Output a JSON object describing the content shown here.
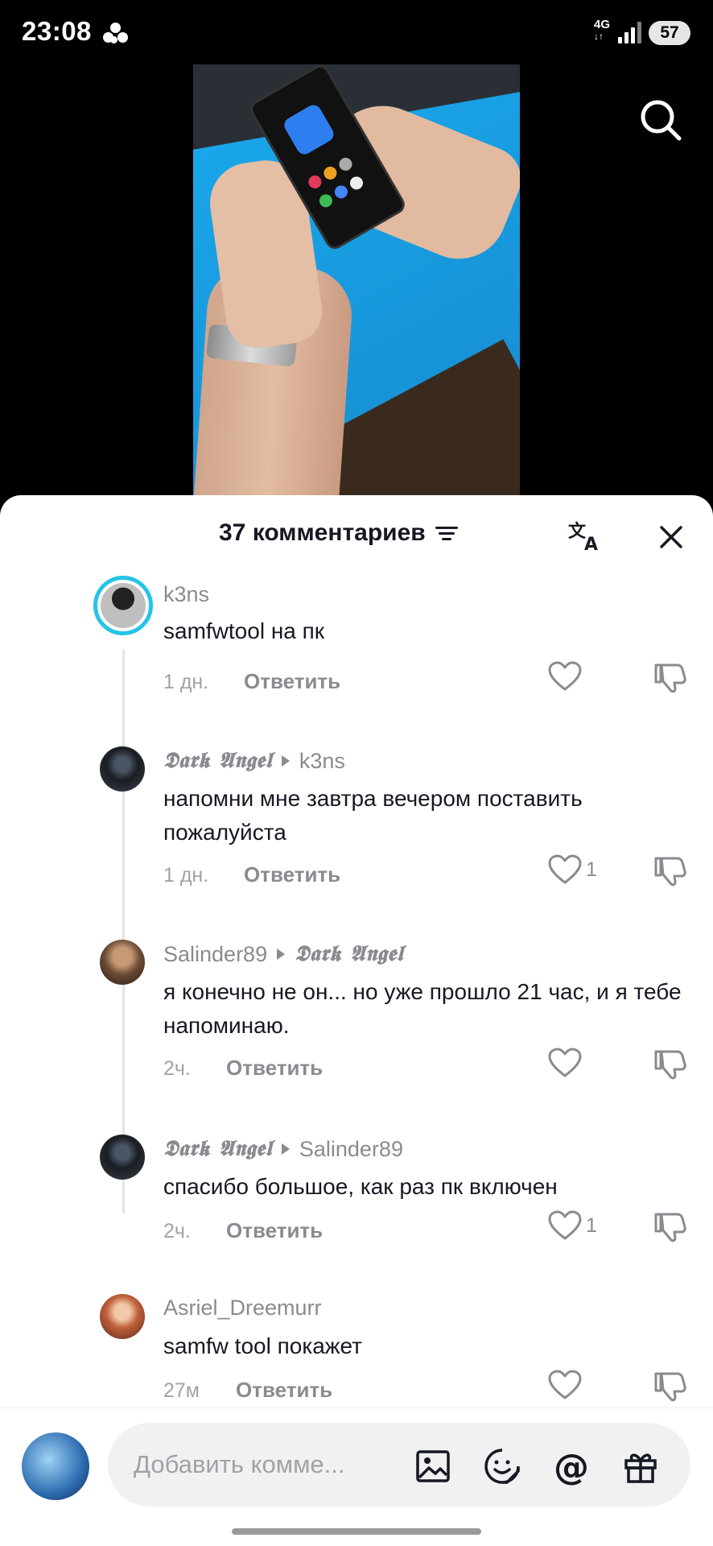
{
  "status_bar": {
    "time": "23:08",
    "network": "4G",
    "battery": "57"
  },
  "icons": {
    "search": "search-icon",
    "translate": "translate-icon",
    "close": "close-icon",
    "filter": "sort-filter-icon",
    "like": "heart-outline-icon",
    "dislike": "thumbs-down-icon",
    "image": "image-icon",
    "emoji": "emoji-icon",
    "mention": "at-icon",
    "gift": "gift-icon"
  },
  "sheet": {
    "title": "37 комментариев"
  },
  "comments": [
    {
      "user": "k3ns",
      "reply_to": "",
      "text": "samfwtool на пк",
      "time": "1 дн.",
      "reply_label": "Ответить",
      "likes": ""
    },
    {
      "user": "𝕯𝖆𝖗𝖐 𝕬𝖓𝖌𝖊𝖑",
      "reply_to": "k3ns",
      "text": "напомни мне завтра вечером поставить пожалуйста",
      "time": "1 дн.",
      "reply_label": "Ответить",
      "likes": "1"
    },
    {
      "user": "Salinder89",
      "reply_to": "𝕯𝖆𝖗𝖐 𝕬𝖓𝖌𝖊𝖑",
      "text": "я конечно не он... но уже прошло 21 час, и я тебе напоминаю.",
      "time": "2ч.",
      "reply_label": "Ответить",
      "likes": ""
    },
    {
      "user": "𝕯𝖆𝖗𝖐 𝕬𝖓𝖌𝖊𝖑",
      "reply_to": "Salinder89",
      "text": "спасибо большое, как раз пк включен",
      "time": "2ч.",
      "reply_label": "Ответить",
      "likes": "1"
    },
    {
      "user": "Asriel_Dreemurr",
      "reply_to": "",
      "text": "samfw tool покажет",
      "time": "27м",
      "reply_label": "Ответить",
      "likes": ""
    }
  ],
  "composer": {
    "placeholder": "Добавить комме..."
  },
  "colors": {
    "accent_ring": "#25c4e6",
    "text_primary": "#161823",
    "text_secondary": "#8a8b91"
  }
}
